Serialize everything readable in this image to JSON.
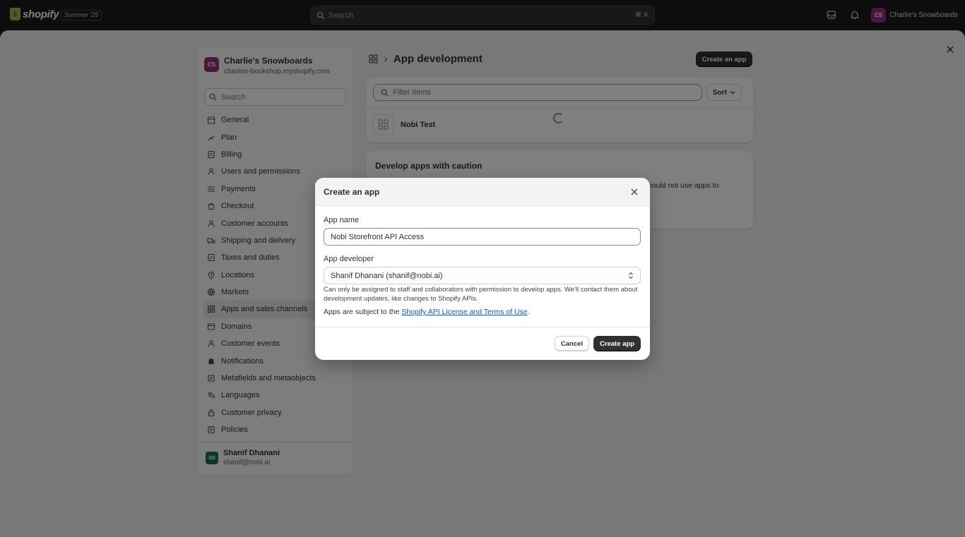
{
  "topbar": {
    "logo_text": "shopify",
    "edition_badge": "Summer '25",
    "search_placeholder": "Search",
    "shortcut": "⌘ K",
    "user_initials": "CS",
    "store_label": "Charlie's Snowboards"
  },
  "nav": {
    "store_initials": "CS",
    "store_name": "Charlie's Snowboards",
    "store_url": "charlies-bookshop.myshopify.com",
    "search_placeholder": "Search",
    "items": [
      {
        "label": "General",
        "icon": "store-icon"
      },
      {
        "label": "Plan",
        "icon": "plan-icon"
      },
      {
        "label": "Billing",
        "icon": "billing-icon"
      },
      {
        "label": "Users and permissions",
        "icon": "users-icon"
      },
      {
        "label": "Payments",
        "icon": "payments-icon"
      },
      {
        "label": "Checkout",
        "icon": "checkout-icon"
      },
      {
        "label": "Customer accounts",
        "icon": "customer-icon"
      },
      {
        "label": "Shipping and delivery",
        "icon": "truck-icon"
      },
      {
        "label": "Taxes and duties",
        "icon": "tax-icon"
      },
      {
        "label": "Locations",
        "icon": "location-icon"
      },
      {
        "label": "Markets",
        "icon": "globe-icon"
      },
      {
        "label": "Apps and sales channels",
        "icon": "apps-icon",
        "active": true
      },
      {
        "label": "Domains",
        "icon": "domains-icon"
      },
      {
        "label": "Customer events",
        "icon": "events-icon"
      },
      {
        "label": "Notifications",
        "icon": "bell-icon"
      },
      {
        "label": "Metafields and metaobjects",
        "icon": "metafields-icon"
      },
      {
        "label": "Languages",
        "icon": "language-icon"
      },
      {
        "label": "Customer privacy",
        "icon": "privacy-icon"
      },
      {
        "label": "Policies",
        "icon": "policies-icon"
      }
    ],
    "user_initials": "SD",
    "user_name": "Shanif Dhanani",
    "user_email": "shanif@nobi.ai"
  },
  "page": {
    "title": "App development",
    "create_button": "Create an app",
    "filter_placeholder": "Filter items",
    "sort_label": "Sort",
    "app_name": "Nobi Test",
    "caution_title": "Develop apps with caution",
    "caution_fragment": "hould not use apps to"
  },
  "modal": {
    "title": "Create an app",
    "app_name_label": "App name",
    "app_name_value": "Nobi Storefront API Access",
    "developer_label": "App developer",
    "developer_value": "Shanif Dhanani (shanif@nobi.ai)",
    "help_text": "Can only be assigned to staff and collaborators with permission to develop apps. We'll contact them about development updates, like changes to Shopify APIs.",
    "terms_prefix": "Apps are subject to the ",
    "terms_link": "Shopify API License and Terms of Use",
    "terms_suffix": ".",
    "cancel_label": "Cancel",
    "create_label": "Create app"
  },
  "colors": {
    "topbar": "#1a1a1a",
    "primary_button": "#303030",
    "link": "#005bd3",
    "store_avatar": "#9b2f7a",
    "user_avatar": "#1f6f5c"
  }
}
